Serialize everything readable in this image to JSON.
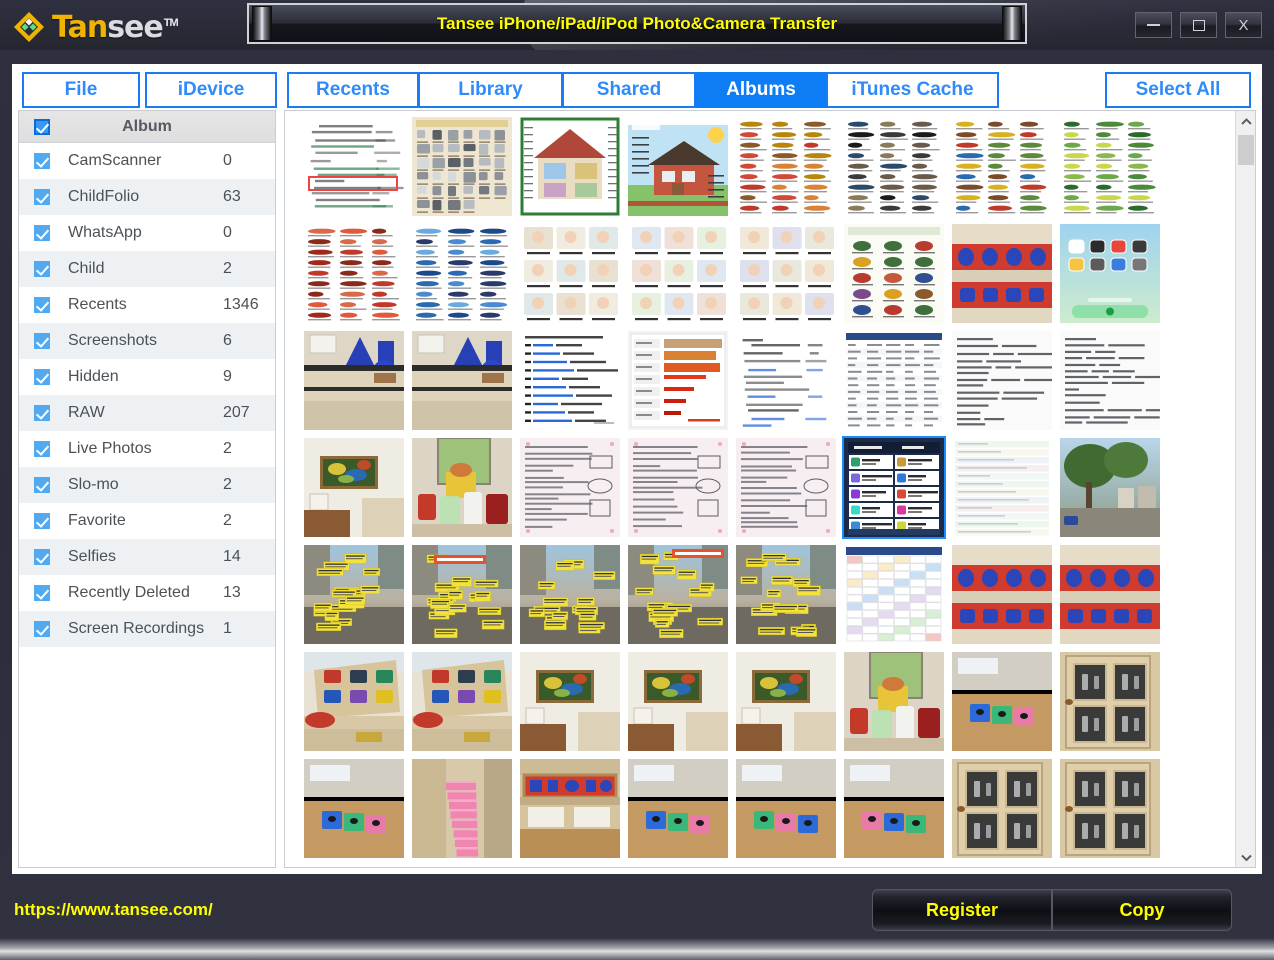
{
  "window": {
    "title": "Tansee iPhone/iPad/iPod Photo&Camera Transfer",
    "logo_primary": "Tan",
    "logo_secondary": "see",
    "logo_tm": "TM",
    "controls": {
      "minimize": "minimize-icon",
      "maximize": "maximize-icon",
      "close": "X"
    },
    "accent_blue": "#0d7cf5",
    "accent_yellow": "#ffff00",
    "frame_color": "#2b2d3c"
  },
  "tabs": {
    "left_group": [
      {
        "label": "File",
        "active": false
      },
      {
        "label": "iDevice",
        "active": false
      }
    ],
    "main_group": [
      {
        "label": "Recents",
        "active": false
      },
      {
        "label": "Library",
        "active": false
      },
      {
        "label": "Shared",
        "active": false
      },
      {
        "label": "Albums",
        "active": true
      },
      {
        "label": "iTunes Cache",
        "active": false
      }
    ],
    "right_group": [
      {
        "label": "Select All",
        "active": false
      }
    ]
  },
  "sidebar": {
    "header": {
      "label": "Album",
      "checked": true
    },
    "items": [
      {
        "label": "CamScanner",
        "count": "0",
        "checked": true
      },
      {
        "label": "ChildFolio",
        "count": "63",
        "checked": true
      },
      {
        "label": "WhatsApp",
        "count": "0",
        "checked": true
      },
      {
        "label": "Child",
        "count": "2",
        "checked": true
      },
      {
        "label": "Recents",
        "count": "1346",
        "checked": true
      },
      {
        "label": "Screenshots",
        "count": "6",
        "checked": true
      },
      {
        "label": "Hidden",
        "count": "9",
        "checked": true
      },
      {
        "label": "RAW",
        "count": "207",
        "checked": true
      },
      {
        "label": "Live Photos",
        "count": "2",
        "checked": true
      },
      {
        "label": "Slo-mo",
        "count": "2",
        "checked": true
      },
      {
        "label": "Favorite",
        "count": "2",
        "checked": true
      },
      {
        "label": "Selfies",
        "count": "14",
        "checked": true
      },
      {
        "label": "Recently Deleted",
        "count": "13",
        "checked": true
      },
      {
        "label": "Screen Recordings",
        "count": "1",
        "checked": true
      }
    ]
  },
  "grid": {
    "columns": 8,
    "rows": 7,
    "scrollbar": {
      "up_icon": "chevron-up-icon",
      "down_icon": "chevron-down-icon",
      "thumb_position_percent": 3
    },
    "thumbnails": [
      {
        "kind": "doc-form",
        "selected": false
      },
      {
        "kind": "poster-appliances",
        "selected": false
      },
      {
        "kind": "poster-house-cut",
        "selected": false
      },
      {
        "kind": "poster-house-parts",
        "selected": false
      },
      {
        "kind": "vocab-sheet-warm",
        "selected": false
      },
      {
        "kind": "vocab-sheet-dark",
        "selected": false
      },
      {
        "kind": "vocab-sheet-mixed",
        "selected": false
      },
      {
        "kind": "vocab-sheet-green",
        "selected": false
      },
      {
        "kind": "vocab-sheet-red",
        "selected": false
      },
      {
        "kind": "vocab-sheet-cool",
        "selected": false
      },
      {
        "kind": "routine-chart-a",
        "selected": false
      },
      {
        "kind": "routine-chart-b",
        "selected": false
      },
      {
        "kind": "routine-chart-c",
        "selected": false
      },
      {
        "kind": "poster-insects",
        "selected": false
      },
      {
        "kind": "photo-red-blue-tray",
        "selected": false
      },
      {
        "kind": "ios-homescreen",
        "selected": false
      },
      {
        "kind": "photo-classroom-cones",
        "selected": false
      },
      {
        "kind": "photo-classroom-cones2",
        "selected": false
      },
      {
        "kind": "doc-ai-list",
        "selected": false
      },
      {
        "kind": "doc-bar-report",
        "selected": false
      },
      {
        "kind": "doc-chinese-list",
        "selected": false
      },
      {
        "kind": "doc-dense-table",
        "selected": false
      },
      {
        "kind": "doc-math-notes",
        "selected": false
      },
      {
        "kind": "doc-handwriting",
        "selected": false
      },
      {
        "kind": "photo-art-wall",
        "selected": false
      },
      {
        "kind": "photo-window-jars",
        "selected": false
      },
      {
        "kind": "doc-pink-notes",
        "selected": false
      },
      {
        "kind": "doc-pink-notes2",
        "selected": false
      },
      {
        "kind": "doc-pink-notes3",
        "selected": false
      },
      {
        "kind": "doc-ai-tools-table",
        "selected": true
      },
      {
        "kind": "doc-stripes-pale",
        "selected": false
      },
      {
        "kind": "photo-street-tree",
        "selected": false
      },
      {
        "kind": "street-labels-a",
        "selected": false
      },
      {
        "kind": "street-labels-b",
        "selected": false
      },
      {
        "kind": "street-labels-c",
        "selected": false
      },
      {
        "kind": "street-labels-d",
        "selected": false
      },
      {
        "kind": "street-labels-e",
        "selected": false
      },
      {
        "kind": "doc-schedule-grid",
        "selected": false
      },
      {
        "kind": "photo-red-blue-tray",
        "selected": false
      },
      {
        "kind": "photo-red-blue-tray2",
        "selected": false
      },
      {
        "kind": "photo-puzzle-board",
        "selected": false
      },
      {
        "kind": "photo-puzzle-board2",
        "selected": false
      },
      {
        "kind": "photo-painting-wall",
        "selected": false
      },
      {
        "kind": "photo-painting-wall2",
        "selected": false
      },
      {
        "kind": "photo-painting-wall3",
        "selected": false
      },
      {
        "kind": "photo-window-jars2",
        "selected": false
      },
      {
        "kind": "photo-blocks-table",
        "selected": false
      },
      {
        "kind": "photo-cabinet-door",
        "selected": false
      },
      {
        "kind": "photo-blocks-desk",
        "selected": false
      },
      {
        "kind": "photo-pink-stairs",
        "selected": false
      },
      {
        "kind": "photo-blue-tray-shelf",
        "selected": false
      },
      {
        "kind": "photo-blocks-wood",
        "selected": false
      },
      {
        "kind": "photo-blocks-wood2",
        "selected": false
      },
      {
        "kind": "photo-blocks-wood3",
        "selected": false
      },
      {
        "kind": "photo-cabinet-door2",
        "selected": false
      },
      {
        "kind": "photo-cabinet-door3",
        "selected": false
      }
    ]
  },
  "footer": {
    "url": "https://www.tansee.com/",
    "register_label": "Register",
    "copy_label": "Copy"
  }
}
